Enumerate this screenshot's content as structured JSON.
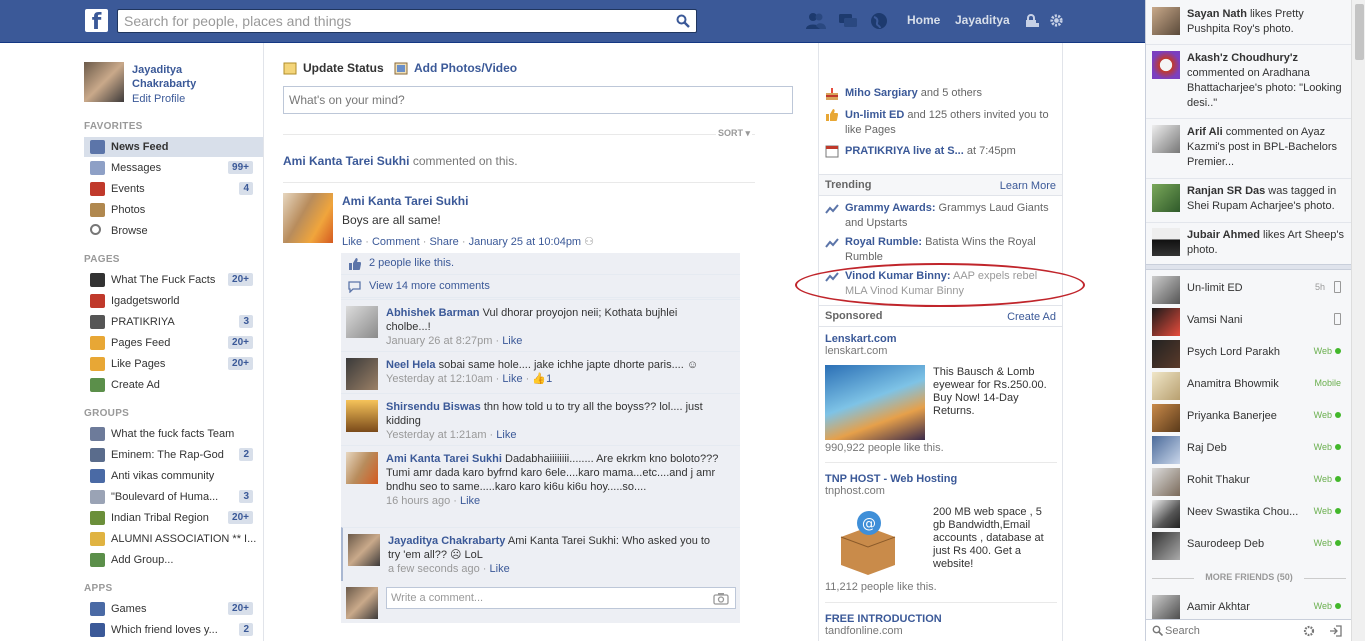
{
  "topbar": {
    "logo": "f",
    "search_placeholder": "Search for people, places and things",
    "home": "Home",
    "user": "Jayaditya"
  },
  "leftnav": {
    "name": "Jayaditya Chakrabarty",
    "edit_profile": "Edit Profile",
    "favorites_head": "FAVORITES",
    "favorites": [
      {
        "label": "News Feed",
        "count": ""
      },
      {
        "label": "Messages",
        "count": "99+"
      },
      {
        "label": "Events",
        "count": "4"
      },
      {
        "label": "Photos",
        "count": ""
      },
      {
        "label": "Browse",
        "count": ""
      }
    ],
    "pages_head": "PAGES",
    "pages": [
      {
        "label": "What The Fuck Facts",
        "count": "20+"
      },
      {
        "label": "Igadgetsworld",
        "count": ""
      },
      {
        "label": "PRATIKRIYA",
        "count": "3"
      },
      {
        "label": "Pages Feed",
        "count": "20+"
      },
      {
        "label": "Like Pages",
        "count": "20+"
      },
      {
        "label": "Create Ad",
        "count": ""
      }
    ],
    "groups_head": "GROUPS",
    "groups": [
      {
        "label": "What the fuck facts Team",
        "count": ""
      },
      {
        "label": "Eminem: The Rap-God",
        "count": "2"
      },
      {
        "label": "Anti vikas community",
        "count": ""
      },
      {
        "label": "\"Boulevard of Huma...",
        "count": "3"
      },
      {
        "label": "Indian Tribal Region",
        "count": "20+"
      },
      {
        "label": "ALUMNI ASSOCIATION ** I...",
        "count": ""
      },
      {
        "label": "Add Group...",
        "count": ""
      }
    ],
    "apps_head": "APPS",
    "apps": [
      {
        "label": "Games",
        "count": "20+"
      },
      {
        "label": "Which friend loves y...",
        "count": "2"
      }
    ]
  },
  "composer": {
    "update_status": "Update Status",
    "add_photos": "Add Photos/Video",
    "placeholder": "What's on your mind?",
    "sort": "SORT"
  },
  "story": {
    "header_actor": "Ami Kanta Tarei Sukhi",
    "header_action": "commented on this.",
    "author": "Ami Kanta Tarei Sukhi",
    "text": "Boys are all same!",
    "actions": {
      "like": "Like",
      "comment": "Comment",
      "share": "Share",
      "time": "January 25 at 10:04pm"
    },
    "likes": "2 people like this.",
    "view_more": "View 14 more comments",
    "comments": [
      {
        "name": "Abhishek Barman",
        "text": "Vul dhorar proyojon neii; Kothata bujhlei cholbe...!",
        "time": "January 26 at 8:27pm",
        "like": "Like",
        "extra": ""
      },
      {
        "name": "Neel Hela",
        "text": "sobai same hole.... jake ichhe japte dhorte paris.... ☺",
        "time": "Yesterday at 12:10am",
        "like": "Like",
        "extra": "1"
      },
      {
        "name": "Shirsendu Biswas",
        "text": "thn how told u to try all the boyss?? lol.... just kidding",
        "time": "Yesterday at 1:21am",
        "like": "Like",
        "extra": ""
      },
      {
        "name": "Ami Kanta Tarei Sukhi",
        "text": "Dadabhaiiiiiiii........ Are ekrkm kno boloto??? Tumi amr dada karo byfrnd karo 6ele....karo mama...etc....and j amr bndhu seo to same.....karo karo ki6u ki6u hoy.....so....",
        "time": "16 hours ago",
        "like": "Like",
        "extra": ""
      },
      {
        "name": "Jayaditya Chakrabarty",
        "text": "Ami Kanta Tarei Sukhi: Who asked you to try 'em all?? ☹ LoL",
        "time": "a few seconds ago",
        "like": "Like",
        "extra": ""
      }
    ],
    "write_comment": "Write a comment..."
  },
  "rightcol": {
    "events": [
      {
        "bold": "Miho Sargiary",
        "rest": " and 5 others"
      },
      {
        "bold": "Un-limit ED",
        "rest": " and 125 others invited you to like Pages"
      },
      {
        "bold": "PRATIKRIYA live at S...",
        "rest": " at 7:45pm"
      }
    ],
    "trending_head": "Trending",
    "learn_more": "Learn More",
    "trending": [
      {
        "bold": "Grammy Awards:",
        "rest": " Grammys Laud Giants and Upstarts"
      },
      {
        "bold": "Royal Rumble:",
        "rest": " Batista Wins the Royal Rumble"
      },
      {
        "bold": "Vinod Kumar Binny:",
        "rest": " AAP expels rebel MLA Vinod Kumar Binny"
      }
    ],
    "sponsored_head": "Sponsored",
    "create_ad": "Create Ad",
    "ads": [
      {
        "title": "Lenskart.com",
        "domain": "lenskart.com",
        "text": "This Bausch & Lomb eyewear for Rs.250.00. Buy Now! 14-Day Returns.",
        "likes": "990,922 people like this."
      },
      {
        "title": "TNP HOST - Web Hosting",
        "domain": "tnphost.com",
        "text": "200 MB web space , 5 gb Bandwidth,Email accounts , database at just Rs 400. Get a website!",
        "likes": "11,212 people like this."
      },
      {
        "title": "FREE INTRODUCTION",
        "domain": "tandfonline.com"
      }
    ]
  },
  "ticker": [
    {
      "bold": "Sayan Nath",
      "rest": " likes Pretty Pushpita Roy's photo."
    },
    {
      "bold": "Akash'z Choudhury'z",
      "rest": " commented on Aradhana Bhattacharjee's photo: \"Looking desi..\""
    },
    {
      "bold": "Arif Ali",
      "rest": " commented on Ayaz Kazmi's post in BPL-Bachelors Premier..."
    },
    {
      "bold": "Ranjan SR Das",
      "rest": " was tagged in Shei Rupam Acharjee's photo."
    },
    {
      "bold": "Jubair Ahmed",
      "rest": " likes Art Sheep's photo."
    }
  ],
  "chat": {
    "friends": [
      {
        "name": "Un-limit ED",
        "status": "5h"
      },
      {
        "name": "Vamsi Nani",
        "status": ""
      },
      {
        "name": "Psych Lord Parakh",
        "status": "Web"
      },
      {
        "name": "Anamitra Bhowmik",
        "status": "Mobile"
      },
      {
        "name": "Priyanka Banerjee",
        "status": "Web"
      },
      {
        "name": "Raj Deb",
        "status": "Web"
      },
      {
        "name": "Rohit Thakur",
        "status": "Web"
      },
      {
        "name": "Neev Swastika Chou...",
        "status": "Web"
      },
      {
        "name": "Saurodeep Deb",
        "status": "Web"
      }
    ],
    "more_friends": "MORE FRIENDS (50)",
    "extra_friend": {
      "name": "Aamir Akhtar",
      "status": "Web"
    },
    "search_placeholder": "Search"
  },
  "colors": {
    "brand": "#3b5998",
    "online": "#42b72a",
    "highlight": "#c0252b"
  }
}
